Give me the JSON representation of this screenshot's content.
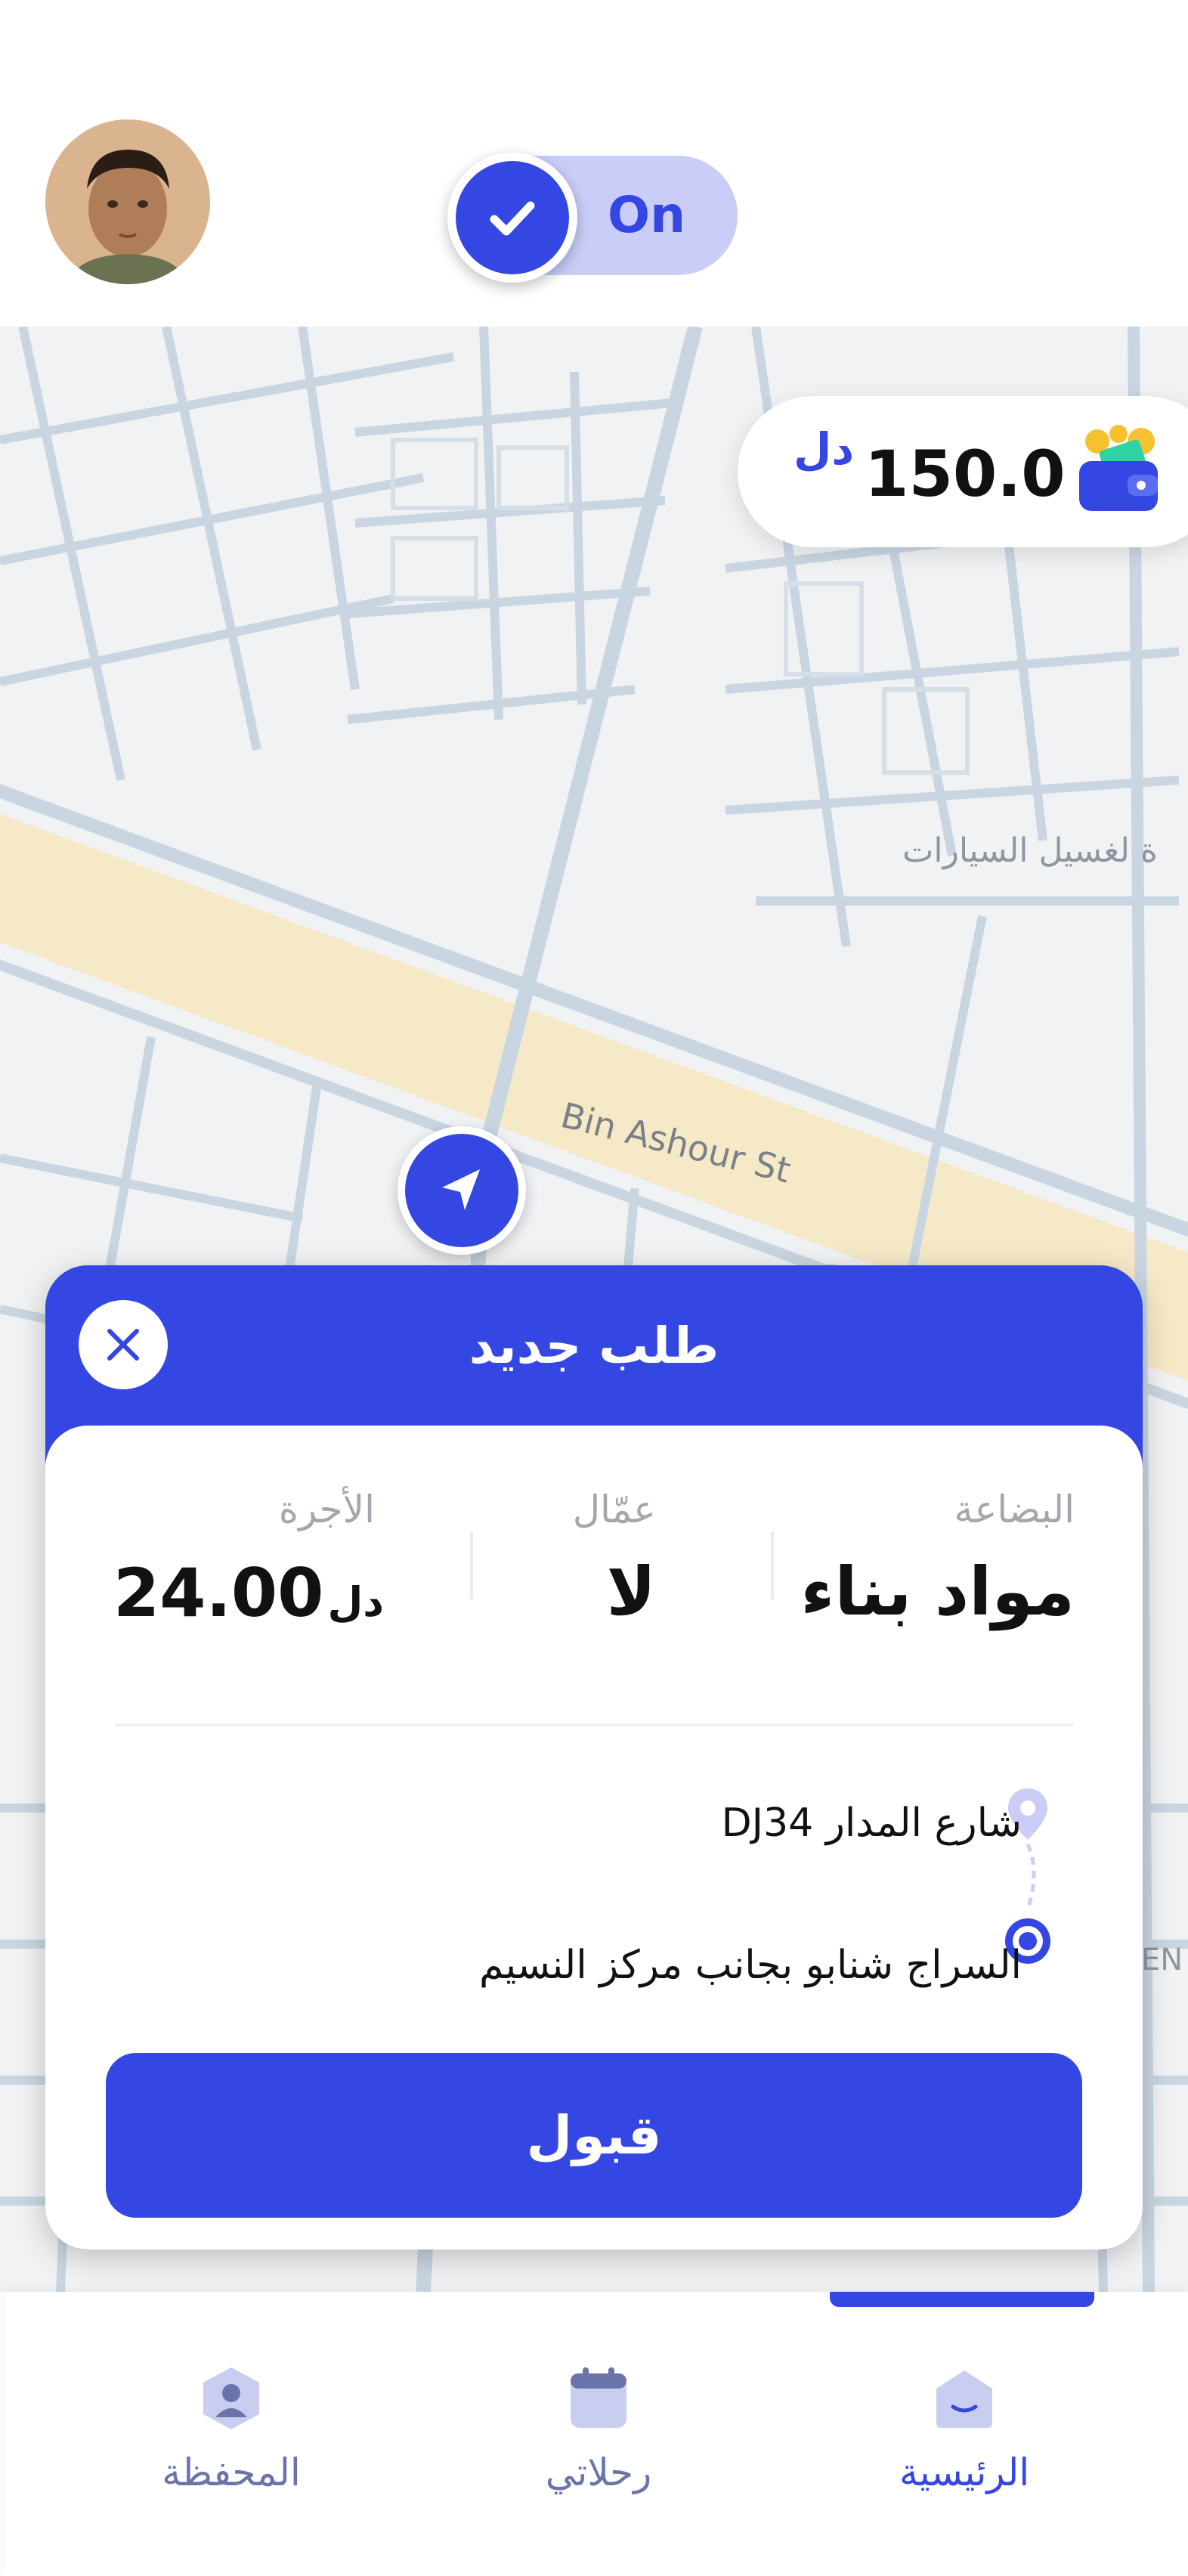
{
  "header": {
    "toggle_label": "On"
  },
  "wallet": {
    "amount": "150.0",
    "currency": "دل"
  },
  "map": {
    "street_label": "Bin Ashour St",
    "poi_label": "ة لغسيل السيارات",
    "edge_label": "EN"
  },
  "order": {
    "title": "طلب جديد",
    "cargo_label": "البضاعة",
    "cargo_value": "مواد بناء",
    "workers_label": "عمّال",
    "workers_value": "لا",
    "fare_label": "الأجرة",
    "fare_amount": "24.00",
    "fare_currency": "دل",
    "pickup": "شارع المدار DJ34",
    "dropoff": "السراج شنابو بجانب مركز النسيم",
    "accept_label": "قبول"
  },
  "nav": {
    "home_label": "الرئيسية",
    "trips_label": "رحلاتي",
    "wallet_label": "المحفظة"
  },
  "colors": {
    "accent": "#3547e3",
    "toggle_track": "#c9cdf8",
    "map_background": "#f1f2f4",
    "map_roads": "#c9d6e2",
    "map_main_road": "#f6e9c8"
  }
}
